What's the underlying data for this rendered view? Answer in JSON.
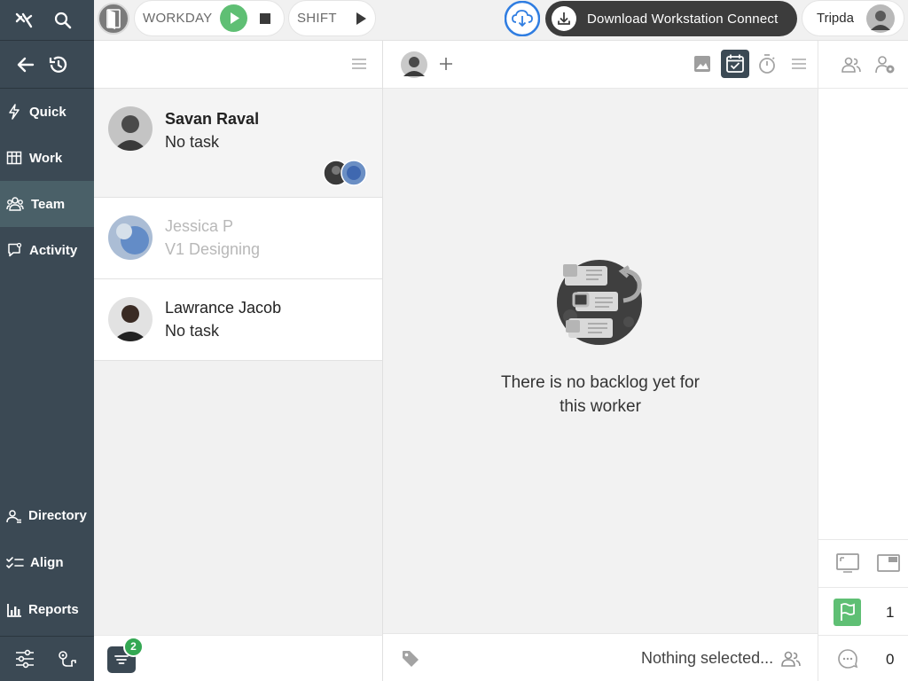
{
  "sidebar": {
    "items": [
      {
        "label": "Quick",
        "icon": "bolt-icon"
      },
      {
        "label": "Work",
        "icon": "kanban-icon"
      },
      {
        "label": "Team",
        "icon": "team-icon"
      },
      {
        "label": "Activity",
        "icon": "chat-icon"
      }
    ],
    "bottom": [
      {
        "label": "Directory",
        "icon": "directory-icon"
      },
      {
        "label": "Align",
        "icon": "checklist-icon"
      },
      {
        "label": "Reports",
        "icon": "bar-chart-icon"
      }
    ]
  },
  "topbar": {
    "workday_label": "WORKDAY",
    "shift_label": "SHIFT",
    "download_label": "Download Workstation Connect",
    "user_name": "Tripda"
  },
  "team": {
    "workers": [
      {
        "name": "Savan Raval",
        "task": "No task",
        "active": true
      },
      {
        "name": "Jessica P",
        "task": "V1 Designing",
        "active": false
      },
      {
        "name": "Lawrance Jacob",
        "task": "No task",
        "active": true
      }
    ],
    "filter_badge": "2"
  },
  "main": {
    "empty_line1": "There is no backlog yet for",
    "empty_line2": "this worker",
    "footer_status": "Nothing selected..."
  },
  "right": {
    "flag_count": "1",
    "comment_count": "0"
  },
  "colors": {
    "sidebar_bg": "#3b4954",
    "accent_green": "#5fbf74",
    "download_bg": "#3c3c3c",
    "cloud_blue": "#2f7de1",
    "badge_green": "#34a853"
  }
}
